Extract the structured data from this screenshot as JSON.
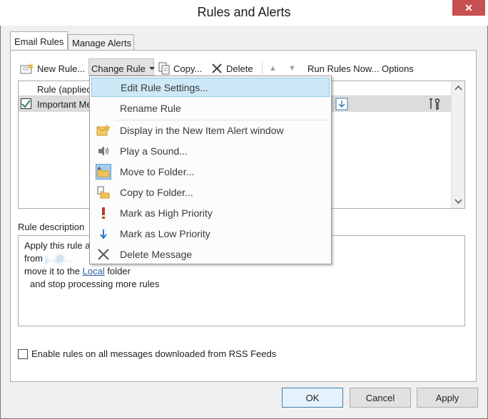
{
  "window": {
    "title": "Rules and Alerts",
    "close_glyph": "✕"
  },
  "tabs": [
    {
      "label": "Email Rules",
      "active": true
    },
    {
      "label": "Manage Alerts",
      "active": false
    }
  ],
  "toolbar": {
    "new_rule": "New Rule...",
    "change_rule": "Change Rule",
    "copy": "Copy...",
    "delete": "Delete",
    "move_up_glyph": "▲",
    "move_down_glyph": "▼",
    "run_rules": "Run Rules Now...",
    "options": "Options"
  },
  "rules_list": {
    "header": "Rule (applied",
    "rows": [
      {
        "name": "Important Me",
        "checked": true
      }
    ]
  },
  "description": {
    "label": "Rule description",
    "line1": "Apply this rule a",
    "line2_prefix": "from",
    "line2_blurred": "j...@...",
    "line3_prefix": "move it to the",
    "line3_link": "Local",
    "line3_suffix": "folder",
    "line4": "and stop processing more rules"
  },
  "rss_option": {
    "label": "Enable rules on all messages downloaded from RSS Feeds",
    "checked": false
  },
  "buttons": {
    "ok": "OK",
    "cancel": "Cancel",
    "apply": "Apply"
  },
  "change_rule_menu": [
    {
      "label": "Edit Rule Settings...",
      "icon": "none",
      "highlighted": true
    },
    {
      "label": "Rename Rule",
      "icon": "none"
    },
    {
      "label": "Display in the New Item Alert window",
      "icon": "new-item-alert-icon"
    },
    {
      "label": "Play a Sound...",
      "icon": "speaker-icon"
    },
    {
      "label": "Move to Folder...",
      "icon": "move-to-folder-icon"
    },
    {
      "label": "Copy to Folder...",
      "icon": "copy-to-folder-icon"
    },
    {
      "label": "Mark as High Priority",
      "icon": "high-priority-icon"
    },
    {
      "label": "Mark as Low Priority",
      "icon": "low-priority-icon"
    },
    {
      "label": "Delete Message",
      "icon": "delete-x-icon"
    }
  ],
  "colors": {
    "accent": "#3c7fb1",
    "menu_highlight": "#cde8f7",
    "high_priority": "#c0392b",
    "low_priority": "#2f78c4"
  }
}
